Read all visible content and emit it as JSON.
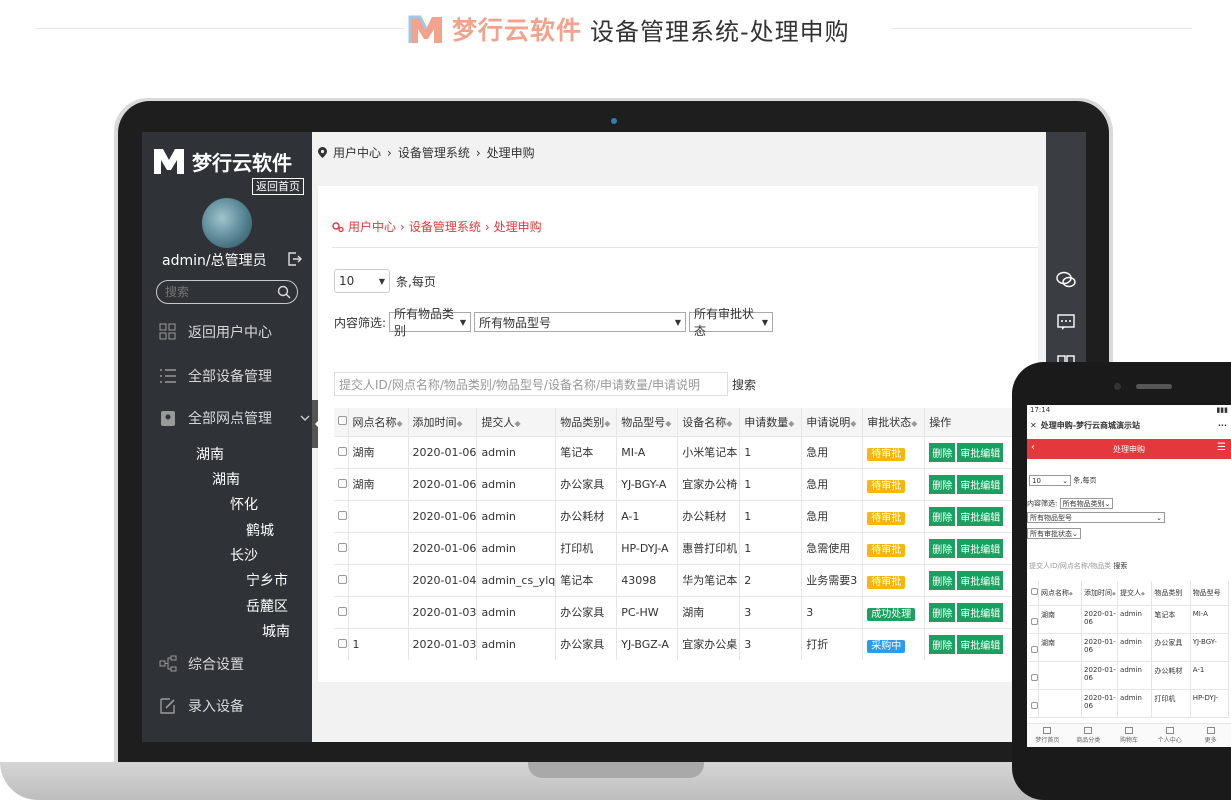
{
  "banner": {
    "brand_name": "梦行云软件",
    "title": "设备管理系统-处理申购",
    "brand_color": "#f3a28c"
  },
  "sidebar": {
    "logo_text": "梦行云软件",
    "back_home": "返回首页",
    "user": "admin/总管理员",
    "search_placeholder": "搜索",
    "items": [
      {
        "label": "返回用户中心",
        "icon": "grid-icon"
      },
      {
        "label": "全部设备管理",
        "icon": "list-icon"
      },
      {
        "label": "全部网点管理",
        "icon": "location-icon"
      },
      {
        "label": "综合设置",
        "icon": "tree-icon"
      },
      {
        "label": "录入设备",
        "icon": "edit-icon"
      }
    ],
    "tree": [
      "湖南",
      "湖南",
      "怀化",
      "鹤城",
      "长沙",
      "宁乡市",
      "岳麓区",
      "城南"
    ]
  },
  "breadcrumb_top": [
    "用户中心",
    "设备管理系统",
    "处理申购"
  ],
  "breadcrumb_panel": [
    "用户中心",
    "设备管理系统",
    "处理申购"
  ],
  "per_page": {
    "value": "10",
    "suffix": "条,每页"
  },
  "filters": {
    "label": "内容筛选:",
    "category": "所有物品类别",
    "model": "所有物品型号",
    "status": "所有审批状态"
  },
  "search": {
    "placeholder": "提交人ID/网点名称/物品类别/物品型号/设备名称/申请数量/申请说明",
    "button": "搜索"
  },
  "table": {
    "headers": [
      "网点名称",
      "添加时间",
      "提交人",
      "物品类别",
      "物品型号",
      "设备名称",
      "申请数量",
      "申请说明",
      "审批状态",
      "操作"
    ],
    "actions": {
      "delete": "删除",
      "edit": "审批编辑"
    },
    "rows": [
      {
        "site": "湖南",
        "time": "2020-01-06",
        "user": "admin",
        "category": "笔记本",
        "model": "MI-A",
        "device": "小米笔记本",
        "qty": "1",
        "note": "急用",
        "status": "待审批",
        "status_color": "#f5b800"
      },
      {
        "site": "湖南",
        "time": "2020-01-06",
        "user": "admin",
        "category": "办公家具",
        "model": "YJ-BGY-A",
        "device": "宜家办公椅",
        "qty": "1",
        "note": "急用",
        "status": "待审批",
        "status_color": "#f5b800"
      },
      {
        "site": "",
        "time": "2020-01-06",
        "user": "admin",
        "category": "办公耗材",
        "model": "A-1",
        "device": "办公耗材",
        "qty": "1",
        "note": "急用",
        "status": "待审批",
        "status_color": "#f5b800"
      },
      {
        "site": "",
        "time": "2020-01-06",
        "user": "admin",
        "category": "打印机",
        "model": "HP-DYJ-A",
        "device": "惠普打印机",
        "qty": "1",
        "note": "急需使用",
        "status": "待审批",
        "status_color": "#f5b800"
      },
      {
        "site": "",
        "time": "2020-01-04",
        "user": "admin_cs_ylq",
        "category": "笔记本",
        "model": "43098",
        "device": "华为笔记本",
        "qty": "2",
        "note": "业务需要3",
        "status": "待审批",
        "status_color": "#f5b800"
      },
      {
        "site": "",
        "time": "2020-01-03",
        "user": "admin",
        "category": "办公家具",
        "model": "PC-HW",
        "device": "湖南",
        "qty": "3",
        "note": "3",
        "status": "成功处理",
        "status_color": "#19a15f"
      },
      {
        "site": "1",
        "time": "2020-01-03",
        "user": "admin",
        "category": "办公家具",
        "model": "YJ-BGZ-A",
        "device": "宜家办公桌",
        "qty": "3",
        "note": "打折",
        "status": "采购中",
        "status_color": "#2f9be8"
      }
    ]
  },
  "phone": {
    "status_time": "17:14",
    "page_title": "处理申购-梦行云商城演示站",
    "nav_title": "处理申购",
    "per_page_value": "10",
    "per_page_suffix": "条,每页",
    "filter_label": "内容筛选:",
    "filter_category": "所有物品类别",
    "filter_model": "所有物品型号",
    "filter_status": "所有审批状态",
    "search_placeholder": "提交人ID/网点名称/物品类",
    "search_button": "搜索",
    "headers": [
      "网点名称",
      "添加时间",
      "提交人",
      "物品类别",
      "物品型号"
    ],
    "rows": [
      {
        "site": "湖南",
        "time": "2020-01-06",
        "user": "admin",
        "category": "笔记本",
        "model": "MI-A"
      },
      {
        "site": "湖南",
        "time": "2020-01-06",
        "user": "admin",
        "category": "办公家具",
        "model": "YJ-BGY-"
      },
      {
        "site": "",
        "time": "2020-01-06",
        "user": "admin",
        "category": "办公耗材",
        "model": "A-1"
      },
      {
        "site": "",
        "time": "2020-01-06",
        "user": "admin",
        "category": "打印机",
        "model": "HP-DYJ-"
      }
    ],
    "tabs": [
      "梦行首页",
      "商品分类",
      "购物车",
      "个人中心",
      "更多"
    ]
  }
}
